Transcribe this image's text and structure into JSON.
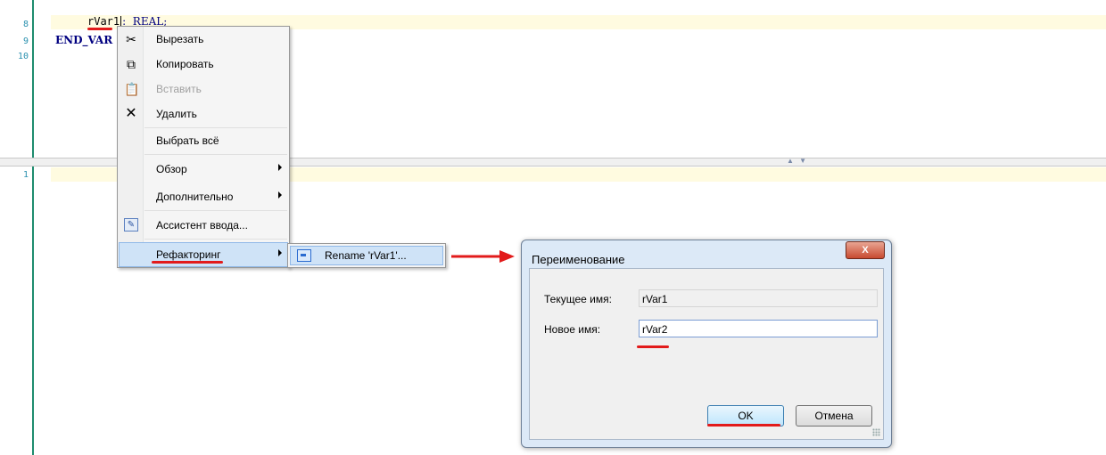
{
  "editor": {
    "line_numbers_top": [
      "8",
      "9",
      "10"
    ],
    "line_numbers_bottom": [
      "1"
    ],
    "line8_var": "rVar1",
    "line8_rest": ":  REAL;",
    "line9": "END_VAR"
  },
  "context_menu": {
    "items": [
      {
        "label": "Вырезать",
        "icon": "cut-icon"
      },
      {
        "label": "Копировать",
        "icon": "copy-icon"
      },
      {
        "label": "Вставить",
        "icon": "paste-icon",
        "disabled": true
      },
      {
        "label": "Удалить",
        "icon": "delete-icon"
      },
      {
        "label": "Выбрать всё"
      },
      {
        "label": "Обзор",
        "submenu": true
      },
      {
        "label": "Дополнительно",
        "submenu": true
      },
      {
        "label": "Ассистент ввода...",
        "icon": "input-assistant-icon"
      },
      {
        "label": "Рефакторинг",
        "submenu": true,
        "active": true
      }
    ]
  },
  "submenu": {
    "label": "Rename 'rVar1'...",
    "icon": "rename-icon"
  },
  "dialog": {
    "title": "Переименование",
    "close_label": "X",
    "current_name_label": "Текущее имя:",
    "current_name_value": "rVar1",
    "new_name_label": "Новое имя:",
    "new_name_value": "rVar2",
    "ok_label": "OK",
    "cancel_label": "Отмена"
  },
  "colors": {
    "annotation": "#e21b1b",
    "highlight_row": "#fffbe0",
    "menu_active": "#cfe3f7"
  }
}
